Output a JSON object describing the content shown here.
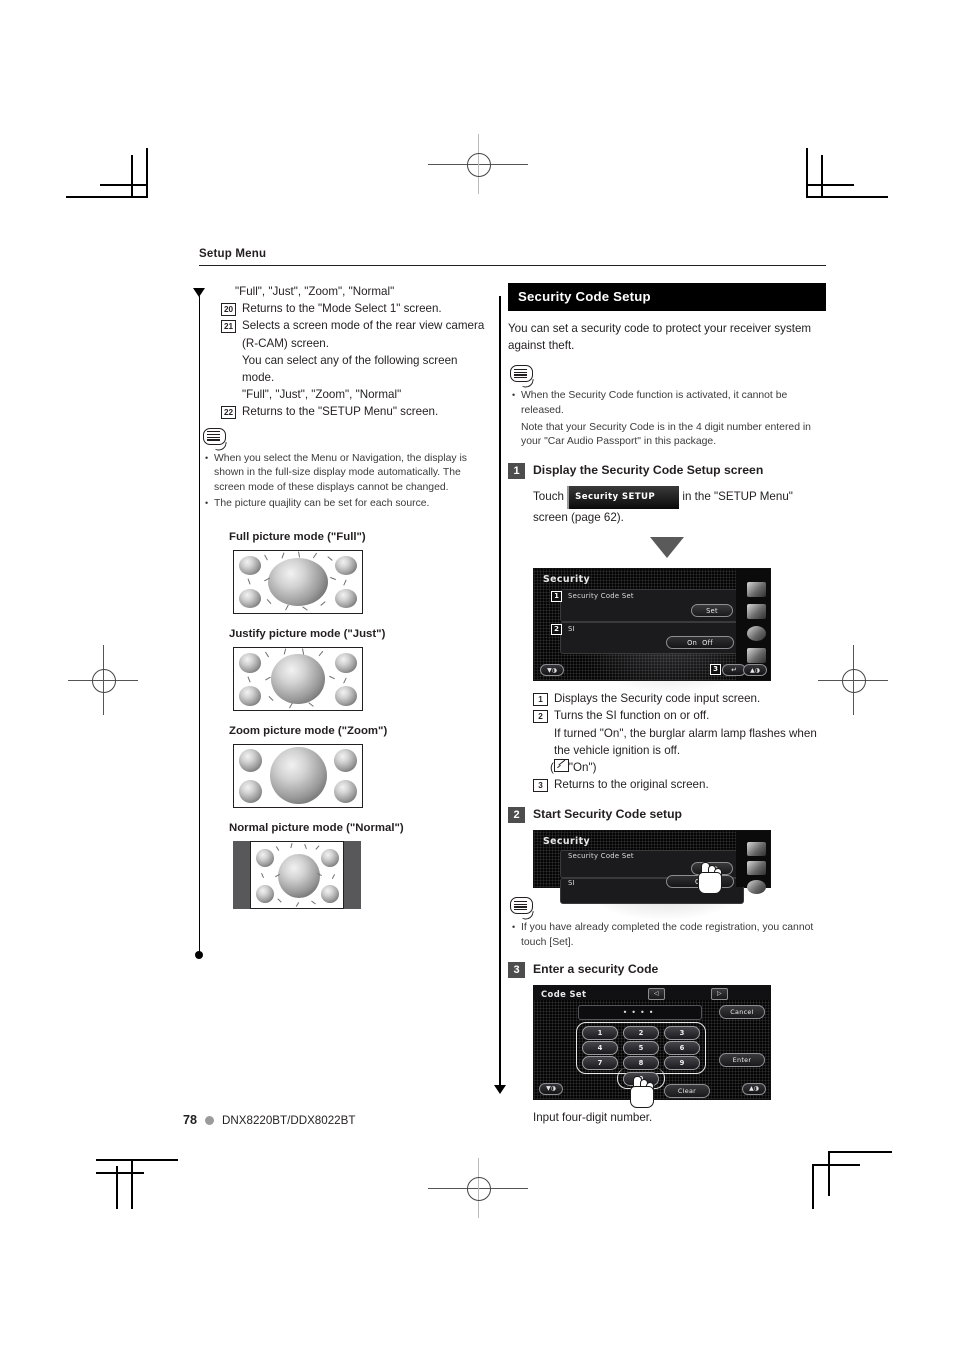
{
  "header": {
    "title": "Setup Menu"
  },
  "left_column": {
    "lead_quote": "\"Full\", \"Just\", \"Zoom\", \"Normal\"",
    "numbered_items": [
      {
        "num": "20",
        "text": "Returns to the \"Mode Select 1\" screen."
      },
      {
        "num": "21",
        "text": "Selects a screen mode of the rear view camera (R-CAM) screen.\nYou can select any of the following screen mode.\n\"Full\", \"Just\", \"Zoom\", \"Normal\""
      },
      {
        "num": "22",
        "text": "Returns to the \"SETUP Menu\" screen."
      }
    ],
    "note_icon": "note-bubble-icon",
    "notes": [
      "When you select the Menu or Navigation, the display is shown in the full-size display mode automatically. The screen mode of these displays cannot be changed.",
      "The picture quajlity can be set for each source."
    ],
    "figures": [
      {
        "title": "Full picture mode (\"Full\")",
        "mode": "full"
      },
      {
        "title": "Justify picture mode (\"Just\")",
        "mode": "just"
      },
      {
        "title": "Zoom picture mode (\"Zoom\")",
        "mode": "zoom"
      },
      {
        "title": "Normal picture mode (\"Normal\")",
        "mode": "normal"
      }
    ]
  },
  "right_column": {
    "section_title": "Security Code Setup",
    "intro": "You can set a security code to protect your receiver system against theft.",
    "note_icon": "note-bubble-icon",
    "notes_1": [
      "When the Security Code function is activated, it cannot be released.",
      "Note that your Security Code is in the 4 digit number entered in your \"Car Audio Passport\" in this package."
    ],
    "step1": {
      "num": "1",
      "title": "Display the Security Code Setup screen",
      "touch_prefix": "Touch",
      "chip_label": "Security SETUP",
      "touch_suffix": "in the \"SETUP Menu\" screen (page 62).",
      "screen": {
        "title": "Security",
        "row1_label": "Security Code Set",
        "row1_button": "Set",
        "row1_marker": "1",
        "row2_label": "SI",
        "row2_on": "On",
        "row2_off": "Off",
        "row2_marker": "2",
        "return_marker": "3"
      },
      "callouts": [
        {
          "num": "1",
          "text": "Displays the Security code input screen."
        },
        {
          "num": "2",
          "text": "Turns the SI function on or off.\nIf turned \"On\", the burglar alarm lamp flashes when the vehicle ignition is off."
        },
        {
          "num": "3",
          "text": "Returns to the original screen."
        }
      ],
      "default_note": "\"On\"",
      "default_icon": "pencil-default-icon"
    },
    "step2": {
      "num": "2",
      "title": "Start Security Code setup",
      "screen": {
        "title": "Security",
        "row1_label": "Security Code Set",
        "row1_button": "Set",
        "row2_label": "SI",
        "row2_on": "On"
      },
      "note_icon": "note-bubble-icon",
      "notes": [
        "If you have already completed the code registration, you cannot touch [Set]."
      ]
    },
    "step3": {
      "num": "3",
      "title": "Enter a security Code",
      "screen": {
        "title": "Code Set",
        "masked_value": "••••",
        "cancel": "Cancel",
        "enter": "Enter",
        "clear": "Clear",
        "keys": [
          "1",
          "2",
          "3",
          "4",
          "5",
          "6",
          "7",
          "8",
          "9",
          "0"
        ],
        "prev_arrow": "◁",
        "next_arrow": "▷"
      },
      "caption": "Input four-digit number."
    }
  },
  "footer": {
    "page_number": "78",
    "model": "DNX8220BT/DDX8022BT"
  }
}
